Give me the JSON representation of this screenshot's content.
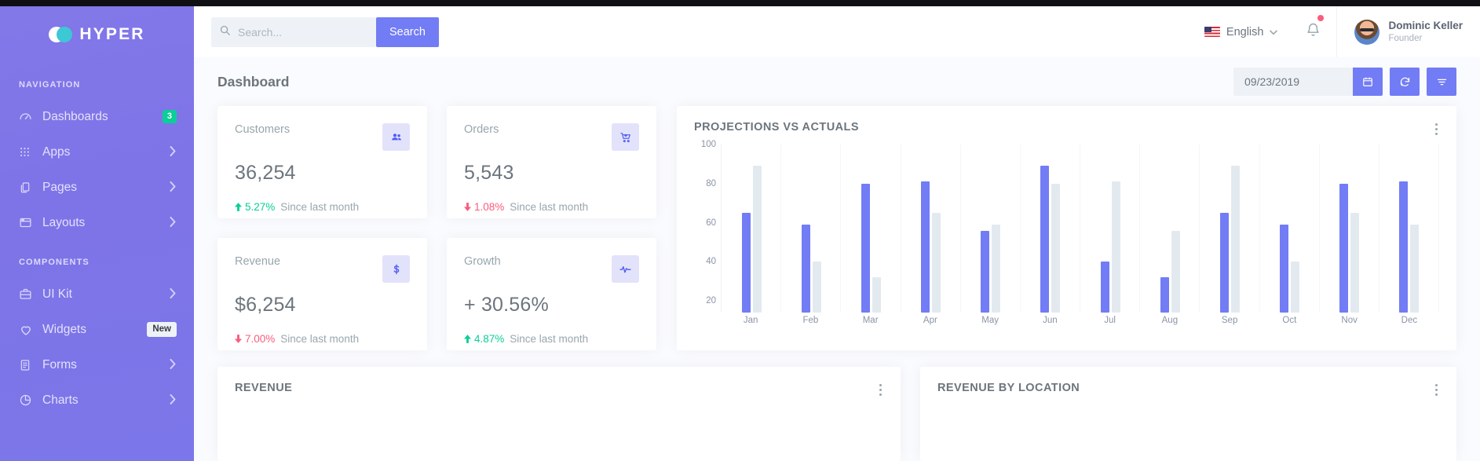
{
  "brand": {
    "name": "HYPER"
  },
  "sidebar": {
    "sections": [
      {
        "label": "NAVIGATION"
      },
      {
        "label": "COMPONENTS"
      }
    ],
    "nav_items": [
      {
        "label": "Dashboards",
        "icon": "gauge-icon",
        "badge": "3",
        "badge_type": "count"
      },
      {
        "label": "Apps",
        "icon": "grid-icon",
        "badge": "",
        "badge_type": "chevron"
      },
      {
        "label": "Pages",
        "icon": "copy-icon",
        "badge": "",
        "badge_type": "chevron"
      },
      {
        "label": "Layouts",
        "icon": "window-icon",
        "badge": "",
        "badge_type": "chevron"
      }
    ],
    "component_items": [
      {
        "label": "UI Kit",
        "icon": "briefcase-icon",
        "badge": "",
        "badge_type": "chevron"
      },
      {
        "label": "Widgets",
        "icon": "heart-icon",
        "badge": "New",
        "badge_type": "new"
      },
      {
        "label": "Forms",
        "icon": "form-icon",
        "badge": "",
        "badge_type": "chevron"
      },
      {
        "label": "Charts",
        "icon": "pie-chart-icon",
        "badge": "",
        "badge_type": "chevron"
      }
    ]
  },
  "header": {
    "search": {
      "placeholder": "Search...",
      "value": "",
      "button_label": "Search"
    },
    "language": {
      "label": "English",
      "flag": "us-flag-icon"
    },
    "notifications": {
      "icon": "bell-icon",
      "has_unread": true
    },
    "user": {
      "name": "Dominic Keller",
      "role": "Founder"
    }
  },
  "page": {
    "title": "Dashboard",
    "date_value": "09/23/2019",
    "actions": [
      {
        "name": "calendar-button",
        "icon": "calendar-icon"
      },
      {
        "name": "refresh-button",
        "icon": "refresh-icon"
      },
      {
        "name": "filter-button",
        "icon": "filter-icon"
      }
    ]
  },
  "stats": [
    {
      "title": "Customers",
      "value": "36,254",
      "pct": "5.27%",
      "direction": "up",
      "since": "Since last month",
      "icon": "users-icon"
    },
    {
      "title": "Orders",
      "value": "5,543",
      "pct": "1.08%",
      "direction": "down",
      "since": "Since last month",
      "icon": "cart-icon"
    },
    {
      "title": "Revenue",
      "value": "$6,254",
      "pct": "7.00%",
      "direction": "down",
      "since": "Since last month",
      "icon": "dollar-icon"
    },
    {
      "title": "Growth",
      "value": "+ 30.56%",
      "pct": "4.87%",
      "direction": "up",
      "since": "Since last month",
      "icon": "pulse-icon"
    }
  ],
  "chart_data": {
    "type": "bar",
    "title": "PROJECTIONS VS ACTUALS",
    "categories": [
      "Jan",
      "Feb",
      "Mar",
      "Apr",
      "May",
      "Jun",
      "Jul",
      "Aug",
      "Sep",
      "Oct",
      "Nov",
      "Dec"
    ],
    "series": [
      {
        "name": "Projections",
        "color": "#727cf5",
        "values": [
          65,
          59,
          80,
          81,
          56,
          89,
          40,
          32,
          65,
          59,
          80,
          81
        ]
      },
      {
        "name": "Actuals",
        "color": "#e3eaef",
        "values": [
          89,
          40,
          32,
          65,
          59,
          80,
          81,
          56,
          89,
          40,
          65,
          59
        ]
      }
    ],
    "ylabel": "",
    "xlabel": "",
    "yticks": [
      100,
      80,
      60,
      40,
      20
    ],
    "ylim": [
      14,
      100
    ],
    "grid": true,
    "legend": "none"
  },
  "panels": [
    {
      "title": "REVENUE",
      "menu_icon": "kebab-menu-icon"
    },
    {
      "title": "REVENUE BY LOCATION",
      "menu_icon": "kebab-menu-icon"
    }
  ],
  "colors": {
    "accent": "#727cf5",
    "sidebar": "#7e74e8",
    "positive": "#0acf97",
    "negative": "#fa5c7c",
    "badge_green": "#0acf97"
  }
}
